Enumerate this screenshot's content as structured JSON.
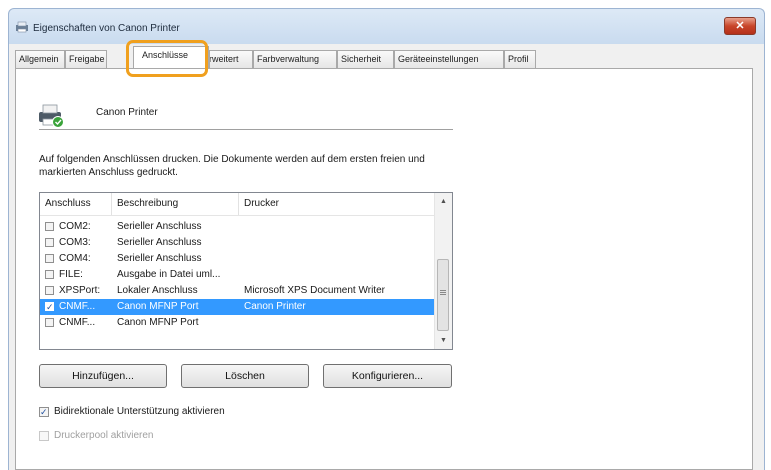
{
  "window": {
    "title": "Eigenschaften von Canon Printer",
    "close_label": "✕"
  },
  "tabs": [
    {
      "label": "Allgemein",
      "active": false
    },
    {
      "label": "Freigabe",
      "active": false
    },
    {
      "label": "Anschlüsse",
      "active": true
    },
    {
      "label": "Erweitert",
      "active": false
    },
    {
      "label": "Farbverwaltung",
      "active": false
    },
    {
      "label": "Sicherheit",
      "active": false
    },
    {
      "label": "Geräteeinstellungen",
      "active": false
    },
    {
      "label": "Profil",
      "active": false
    }
  ],
  "printer": {
    "name": "Canon Printer"
  },
  "instructions": "Auf folgenden Anschlüssen drucken. Die Dokumente werden auf dem ersten freien und markierten Anschluss gedruckt.",
  "ports_table": {
    "columns": [
      "Anschluss",
      "Beschreibung",
      "Drucker"
    ],
    "rows": [
      {
        "port": "COM2:",
        "description": "Serieller Anschluss",
        "printer": "",
        "checked": false,
        "selected": false
      },
      {
        "port": "COM3:",
        "description": "Serieller Anschluss",
        "printer": "",
        "checked": false,
        "selected": false
      },
      {
        "port": "COM4:",
        "description": "Serieller Anschluss",
        "printer": "",
        "checked": false,
        "selected": false
      },
      {
        "port": "FILE:",
        "description": "Ausgabe in Datei uml...",
        "printer": "",
        "checked": false,
        "selected": false
      },
      {
        "port": "XPSPort:",
        "description": "Lokaler Anschluss",
        "printer": "Microsoft XPS Document Writer",
        "checked": false,
        "selected": false
      },
      {
        "port": "CNMF...",
        "description": "Canon MFNP Port",
        "printer": "Canon Printer",
        "checked": true,
        "selected": true
      },
      {
        "port": "CNMF...",
        "description": "Canon MFNP Port",
        "printer": "",
        "checked": false,
        "selected": false
      }
    ]
  },
  "buttons": {
    "add": "Hinzufügen...",
    "delete": "Löschen",
    "configure": "Konfigurieren..."
  },
  "options": {
    "bidirectional": {
      "label": "Bidirektionale Unterstützung aktivieren",
      "checked": true,
      "enabled": true
    },
    "pool": {
      "label": "Druckerpool aktivieren",
      "checked": false,
      "enabled": false
    }
  },
  "icons": {
    "checkmark": "✓",
    "scroll_up": "▲",
    "scroll_down": "▼"
  },
  "colors": {
    "highlight": "#f0a01e",
    "selection": "#3399ff"
  }
}
